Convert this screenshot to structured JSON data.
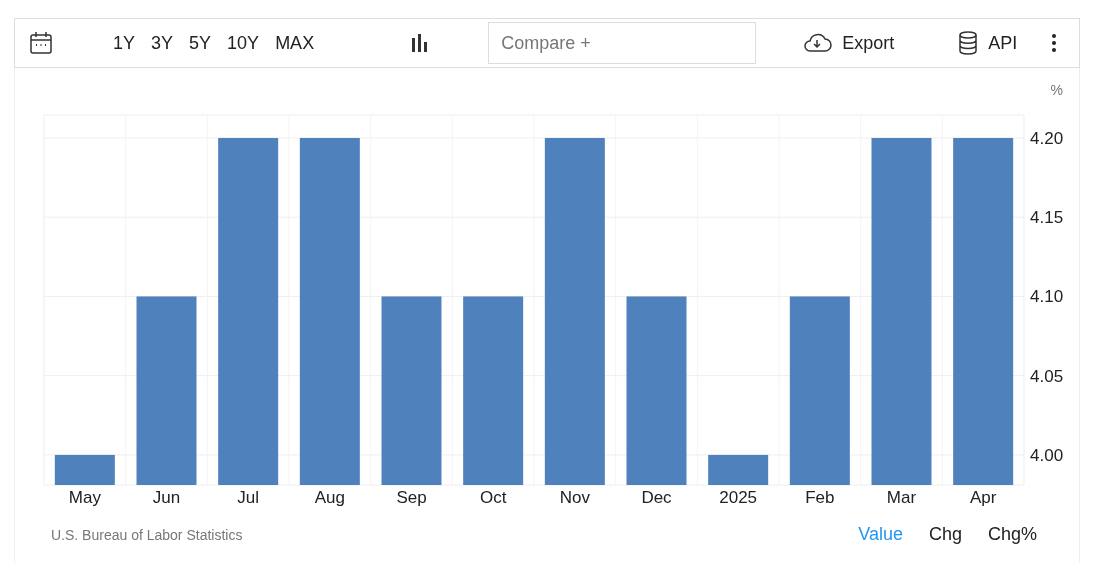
{
  "toolbar": {
    "ranges": [
      "1Y",
      "3Y",
      "5Y",
      "10Y",
      "MAX"
    ],
    "compare": {
      "placeholder": "Compare +"
    },
    "export": "Export",
    "api": "API"
  },
  "chart": {
    "unit": "%",
    "chart_data": {
      "type": "bar",
      "categories": [
        "May",
        "Jun",
        "Jul",
        "Aug",
        "Sep",
        "Oct",
        "Nov",
        "Dec",
        "2025",
        "Feb",
        "Mar",
        "Apr"
      ],
      "grid": true,
      "series": [
        {
          "color": "#4f81bd",
          "values": [
            4.0,
            4.1,
            4.2,
            4.2,
            4.1,
            4.1,
            4.2,
            4.1,
            4.0,
            4.1,
            4.2,
            4.2
          ]
        }
      ],
      "ylim": [
        3.981,
        4.2145
      ],
      "yticks": [
        {
          "value": 4.0,
          "label": "4.00"
        },
        {
          "value": 4.05,
          "label": "4.05"
        },
        {
          "value": 4.1,
          "label": "4.10"
        },
        {
          "value": 4.15,
          "label": "4.15"
        },
        {
          "value": 4.2,
          "label": "4.20"
        }
      ]
    }
  },
  "footer": {
    "source": "U.S. Bureau of Labor Statistics",
    "views": [
      {
        "label": "Value",
        "selected": true
      },
      {
        "label": "Chg",
        "selected": false
      },
      {
        "label": "Chg%",
        "selected": false
      }
    ]
  }
}
